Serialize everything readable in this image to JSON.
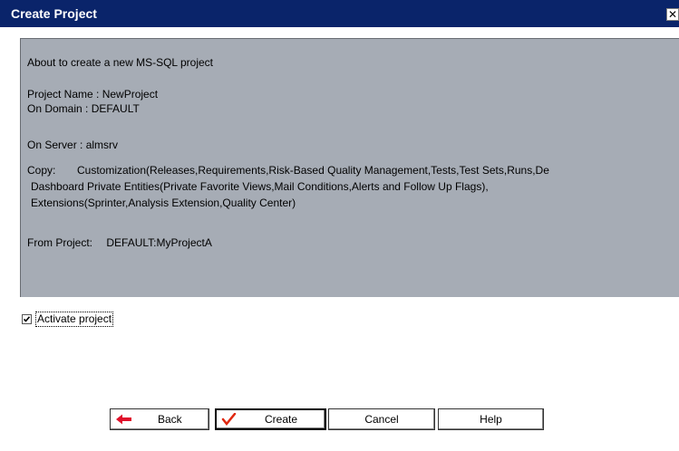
{
  "window": {
    "title": "Create Project",
    "close_glyph": "✕"
  },
  "summary": {
    "intro": "About to create a new MS-SQL project",
    "project_name": "Project Name : NewProject",
    "domain": "On Domain : DEFAULT",
    "server": "On Server : almsrv",
    "copy_label": "Copy:",
    "copy_lines": [
      "Customization(Releases,Requirements,Risk-Based Quality Management,Tests,Test Sets,Runs,De",
      "Dashboard Private Entities(Private Favorite Views,Mail Conditions,Alerts and Follow Up Flags),",
      "Extensions(Sprinter,Analysis Extension,Quality Center)"
    ],
    "from_project_label": "From Project:",
    "from_project_value": "DEFAULT:MyProjectA"
  },
  "activate": {
    "label": "Activate project",
    "checked": true
  },
  "buttons": {
    "back": "Back",
    "create": "Create",
    "cancel": "Cancel",
    "help": "Help"
  },
  "icons": {
    "back": "red-left-arrow-icon",
    "create": "red-checkmark-icon"
  },
  "colors": {
    "titlebar": "#0a246a",
    "panel": "#a6acb5",
    "back_arrow": "#e0102a",
    "create_check": "#e02810"
  }
}
